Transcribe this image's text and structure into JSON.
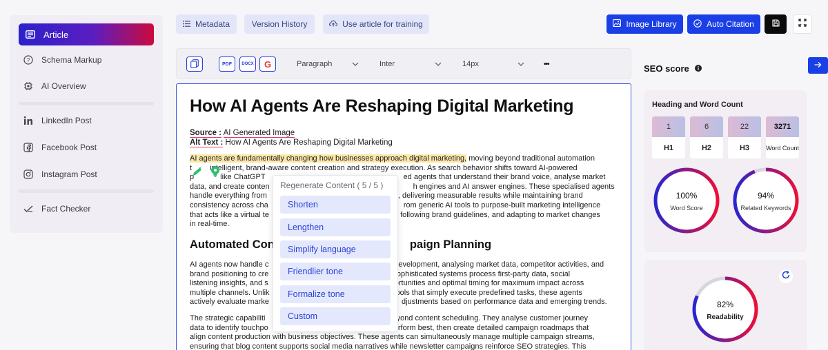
{
  "sidebar": {
    "active": {
      "label": "Article",
      "icon": "article-icon"
    },
    "items": [
      {
        "label": "Schema Markup",
        "icon": "help-circle-icon"
      },
      {
        "label": "AI Overview",
        "icon": "chip-icon"
      },
      {
        "label": "LinkedIn Post",
        "icon": "linkedin-icon"
      },
      {
        "label": "Facebook Post",
        "icon": "facebook-icon"
      },
      {
        "label": "Instagram Post",
        "icon": "instagram-icon"
      },
      {
        "label": "Fact Checker",
        "icon": "check-icon"
      }
    ]
  },
  "toolbar": {
    "metadata": "Metadata",
    "version_history": "Version History",
    "use_for_training": "Use article for training",
    "image_library": "Image Library",
    "auto_citation": "Auto Citation"
  },
  "editor_toolbar": {
    "pdf": "PDF",
    "docx": "DOCX",
    "google": "G",
    "paragraph": "Paragraph",
    "font": "Inter",
    "size": "14px",
    "more": "•••"
  },
  "article": {
    "title": "How AI Agents Are Reshaping Digital Marketing",
    "source_label": "Source :",
    "source_value": "AI Generated Image",
    "alt_label": "Alt Text :",
    "alt_value": "How AI Agents Are Reshaping Digital Marketing",
    "p1_highlight": "AI agents are fundamentally changing how businesses approach digital marketing,",
    "p1_l1_rest": " moving beyond traditional automation",
    "p1_l2_left": "t",
    "p1_l2_mid": "intelligent, brand-aware content creation and strategy execution. As search behavior shifts toward AI-powered",
    "p1_l3_left": "p",
    "p1_l3_mid": "like ChatGPT",
    "p1_l3_right": "ed agents that understand their brand voice, analyse market",
    "p1_l4_left": "data, and create conten",
    "p1_l4_right": "h engines and AI answer engines. These specialised agents",
    "p1_l5_left": "handle everything from",
    "p1_l5_right": ", delivering measurable results while maintaining brand",
    "p1_l6_left": "consistency across cha",
    "p1_l6_right": "rom generic AI tools to purpose-built marketing intelligence",
    "p1_l7_left": "that acts like a virtual te",
    "p1_l7_right": ", following brand guidelines, and adapting to market changes",
    "p1_l8": "in real-time.",
    "h2_left": "Automated Con",
    "h2_right": "paign Planning",
    "p2_l1_left": "AI agents now handle c",
    "p2_l1_right": "evelopment, analysing market data, competitor activities, and",
    "p2_l2_left": "brand positioning to cre",
    "p2_l2_right": "sophisticated systems process first-party data, social",
    "p2_l3_left": "listening insights, and s",
    "p2_l3_right": "ortunities and optimal timing for maximum impact across",
    "p2_l4_left": "multiple channels. Unlik",
    "p2_l4_right": "ools that simply execute predefined tasks, these agents",
    "p2_l5_left": "actively evaluate marke",
    "p2_l5_right": "djustments based on performance data and emerging trends.",
    "p3_l1_left": "The strategic capabiliti",
    "p3_l1_right": "eyond content scheduling. They analyse customer journey",
    "p3_l2_left": "data to identify touchpo",
    "p3_l2_right": "erform best, then create detailed campaign roadmaps that",
    "p3_l3": "align content production with business objectives. These agents can simultaneously manage multiple campaign streams,",
    "p3_l4": "ensuring that blog content supports social media narratives while newsletter campaigns reinforce SEO strategies. This"
  },
  "popup": {
    "header": "Regenerate Content ( 5 / 5 )",
    "options": [
      "Shorten",
      "Lengthen",
      "Simplify language",
      "Friendlier tone",
      "Formalize tone",
      "Custom"
    ]
  },
  "seo": {
    "title": "SEO score",
    "card_title": "Heading and Word Count",
    "counts": [
      {
        "value": "1",
        "label": "H1"
      },
      {
        "value": "6",
        "label": "H2"
      },
      {
        "value": "22",
        "label": "H3"
      },
      {
        "value": "3271",
        "label": "Word Count"
      }
    ],
    "word_score": {
      "value": "100%",
      "label": "Word Score",
      "fraction": 1.0
    },
    "related_keywords": {
      "value": "94%",
      "label": "Related Keywords",
      "fraction": 0.94
    },
    "readability": {
      "value": "82%",
      "label": "Readability",
      "fraction": 0.82
    }
  },
  "colors": {
    "accent": "#1b3fe6",
    "gradient_start": "#2b21c9",
    "gradient_end": "#cc0a3d",
    "ring_start": "#2a25d0",
    "ring_end": "#ee0e36",
    "ring_track": "#d6d6dc"
  }
}
